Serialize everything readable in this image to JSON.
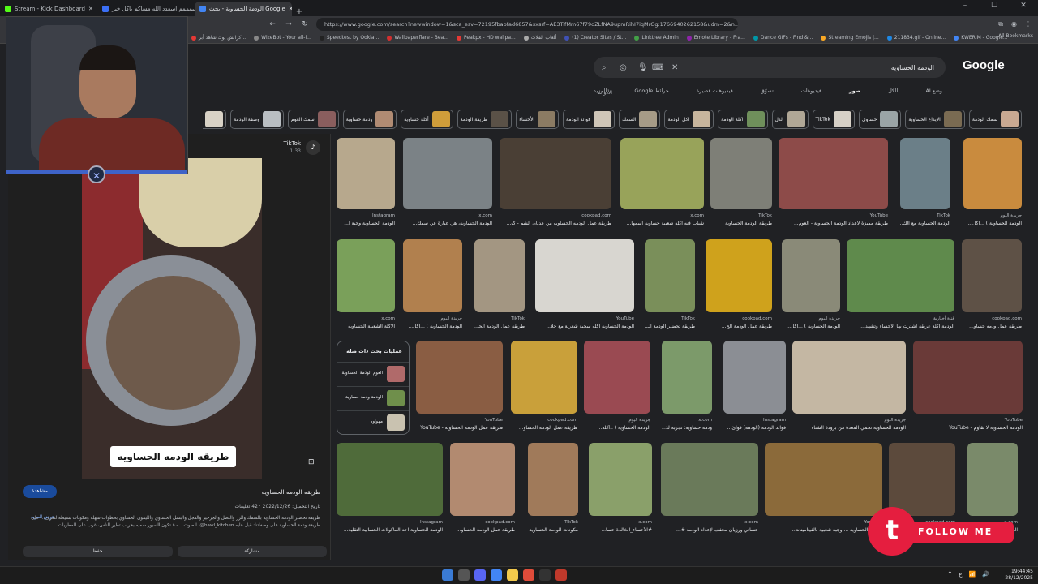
{
  "browser": {
    "tabs": [
      {
        "label": "Stream - Kick Dashboard",
        "color": "#53fc18"
      },
      {
        "label": "حييمممم اسعدد الله مساكم ياكل خير ||",
        "color": "#3b6ff5"
      },
      {
        "label": "الودمة الحساوية - بحث Google",
        "color": "#4285f4",
        "active": true
      }
    ],
    "new_tab": "+",
    "window_controls": [
      "–",
      "☐",
      "✕"
    ],
    "url": "https://www.google.com/search?newwindow=1&sca_esv=72195fbabfad6857&sxsrf=AE3TifMm67f79dZLfNA9upmRihI7iqMrGg:1766940262158&udm=2&n...",
    "bookmarks": [
      {
        "label": "كرانش يوك شاهد أبر...",
        "color": "#e53935"
      },
      {
        "label": "WizeBot - Your all-i...",
        "color": "#888888"
      },
      {
        "label": "Speedtest by Ookla...",
        "color": "#222222"
      },
      {
        "label": "Wallpaperflare - Bea...",
        "color": "#d32f2f"
      },
      {
        "label": "Peakpx - HD wallpa...",
        "color": "#e53935"
      },
      {
        "label": "ألعاب الفلات",
        "color": "#aaaaaa"
      },
      {
        "label": "(1) Creator Sites / St...",
        "color": "#3f51b5"
      },
      {
        "label": "Linktree Admin",
        "color": "#43a047"
      },
      {
        "label": "Emote Library - Fra...",
        "color": "#8e24aa"
      },
      {
        "label": "Dance GIFs - Find &...",
        "color": "#0097a7"
      },
      {
        "label": "Streaming Emojis |...",
        "color": "#f9a825"
      },
      {
        "label": "211834.gif - Online...",
        "color": "#1e88e5"
      },
      {
        "label": "KWERIM - Google...",
        "color": "#4285f4"
      }
    ],
    "all_bookmarks": "All Bookmarks"
  },
  "google": {
    "logo": "Google",
    "query": "الودمة الحساوية",
    "filters": [
      "وضع AI",
      "الكل",
      "صور",
      "فيديوهات",
      "تسوّق",
      "فيديوهات قصيرة",
      "خرائط Google",
      "المزيد"
    ],
    "active_filter": "صور",
    "tools": "الأدوات",
    "chips": [
      {
        "label": "سمك الودمة",
        "color": "#c9a992"
      },
      {
        "label": "الإبداع الحساوية",
        "color": "#7a6b52"
      },
      {
        "label": "حساوي",
        "color": "#9aa4a6"
      },
      {
        "label": "TikTok",
        "color": "#d6d0c6"
      },
      {
        "label": "الدل",
        "color": "#b0a796"
      },
      {
        "label": "اكلة الودمة",
        "color": "#6f8f5b"
      },
      {
        "label": "اكل الودمة",
        "color": "#c7b59d"
      },
      {
        "label": "السمك",
        "color": "#a69b87"
      },
      {
        "label": "فوائد الودمة",
        "color": "#cfc6b8"
      },
      {
        "label": "الأحساء",
        "color": "#8b7b63"
      },
      {
        "label": "طريقة الودمة",
        "color": "#5a5147"
      },
      {
        "label": "أكلة حساويه",
        "color": "#cf9d3a"
      },
      {
        "label": "ودمة حساوية",
        "color": "#b08b73"
      },
      {
        "label": "سمك العوم",
        "color": "#8a5e5e"
      },
      {
        "label": "وصفة الودمة",
        "color": "#b9bec2"
      },
      {
        "label": "عمل الودمة",
        "color": "#d8d2c6"
      }
    ]
  },
  "viewer": {
    "source": "TikTok",
    "duration": "1:33",
    "caption": "طريقه الودمه الحساويه",
    "visit": "مشاهدة",
    "title": "طريقه الودمه الحساويه",
    "meta": "تاريخ التحميل: 2022/12/26 · 42 تعليقات",
    "description": "طريقة تحضير الودمه الحساويه بالسمك والرز والبصل والجرجير والفجل والبسل الحساوي والليمون الحساوي بخطوات سهلة ومكونات بسيطة لتعرف... على طريقة ودمة الحساوية على وصفاتنا: قبل عليه hawl_kitchen@، الصوت... - ٥ تكون السيور سميه بحريب تطير الناس، غرب على المطويات",
    "more": "عرض المزيد",
    "actions": [
      "حفظ",
      "مشاركة"
    ]
  },
  "related": {
    "heading": "عمليات بحث ذات صلة",
    "items": [
      {
        "label": "العوم الودمة الحساوية",
        "color": "#b06a6a"
      },
      {
        "label": "الودمة ودمة حساوية",
        "color": "#6f8f4b"
      },
      {
        "label": "مهواوه",
        "color": "#c9c2b0"
      }
    ]
  },
  "grid": {
    "cards": [
      {
        "src": "Instagram",
        "title": "الودمة الحساوية وجبة ا...",
        "color": "#b7a88d"
      },
      {
        "src": "x.com",
        "title": "الودمة الحساوية، هي عبارة عن سمك...",
        "color": "#7b8286"
      },
      {
        "src": "cookpad.com",
        "title": "طريقة عمل الودمه الحساويه من عدنان الشم - ک...",
        "color": "#4a3f35"
      },
      {
        "src": "x.com",
        "title": "شباب فيه أكله شعبية حساوية اسمها...",
        "color": "#98a35a"
      },
      {
        "src": "TikTok",
        "title": "طريقة الودمة الحساوية",
        "color": "#7e7f77"
      },
      {
        "src": "YouTube",
        "title": "طريقة مميزة لاعداد الودمة الحساوية - العوم...",
        "color": "#8d4b49"
      },
      {
        "src": "TikTok",
        "title": "الودمة الحساوية مع الك...",
        "color": "#6b7f88"
      },
      {
        "src": "جريدة اليوم",
        "title": "الودمة الحساوية ) ...أكل...",
        "color": "#c98b3e"
      },
      {
        "src": "x.com",
        "title": "الأكلة الشعبية الحساويه",
        "color": "#7aa05a"
      },
      {
        "src": "جريدة اليوم",
        "title": "الودمة الحساوية ) ...أكل...",
        "color": "#b1804e"
      },
      {
        "src": "TikTok",
        "title": "طريقة عمل الودمة الحـ...",
        "color": "#a39682"
      },
      {
        "src": "YouTube",
        "title": "الودمة الحساوية أكله سحبة شعرية مع حلا...",
        "color": "#d8d6d0"
      },
      {
        "src": "TikTok",
        "title": "طريقة تحضير الودمة الـ...",
        "color": "#7a8f5a"
      },
      {
        "src": "cookpad.com",
        "title": "طريقة عمل الودمة الح...",
        "color": "#cfa21c"
      },
      {
        "src": "جريدة اليوم",
        "title": "الودمة الحساوية ) ...أكل...",
        "color": "#8a8a78"
      },
      {
        "src": "قناة أخبارية",
        "title": "الودمة أكلة عريقة اشترت بها الأحساء وتشهد...",
        "color": "#5f8a4c"
      },
      {
        "src": "cookpad.com",
        "title": "طريقة عمل ودمه حساو...",
        "color": "#5e5146"
      },
      {
        "src": "YouTube",
        "title": "طريقة عمل الودمة الحساوية - YouTube",
        "color": "#8a5d43"
      },
      {
        "src": "cookpad.com",
        "title": "طريقة عمل الودمه الحساو...",
        "color": "#c9a03a"
      },
      {
        "src": "جريدة اليوم",
        "title": "الودمة الحساوية ) ..أكلة...",
        "color": "#9a4a52"
      },
      {
        "src": "x.com",
        "title": "ودمه حساوية: تجربة لذ...",
        "color": "#7c9a6a"
      },
      {
        "src": "Instagram",
        "title": "فوائد الودمة (الودمه) فوائ...",
        "color": "#8b8e94"
      },
      {
        "src": "جريدة اليوم",
        "title": "الودمة الحساوية تحمي المعدة من برودة الشتاء",
        "color": "#c4b7a3"
      },
      {
        "src": "YouTube",
        "title": "الودمة الحساوية لا تقاوم - YouTube",
        "color": "#6a3a38"
      },
      {
        "src": "Instagram",
        "title": "الودمة الحساوية احد الماكولات الحسائية التقليد...",
        "color": "#4f6b3a"
      },
      {
        "src": "cookpad.com",
        "title": "طريقة عمل الودمة الحساو...",
        "color": "#b28a70"
      },
      {
        "src": "TikTok",
        "title": "مكونات الودمة الحساوية",
        "color": "#a07a5a"
      },
      {
        "src": "x.com",
        "title": "#الأحساء_الخالدة حسا...",
        "color": "#8aa06a"
      },
      {
        "src": "x.com",
        "title": "حساني ورزيان مجفف لإعداد الودمة #...",
        "color": "#6a7a5a"
      },
      {
        "src": "YouTube",
        "title": "الودمة الحساوية ... وجبة شعبية بالفيتامينات...",
        "color": "#8b6a3a"
      },
      {
        "src": "cookpad.com",
        "title": "الودمه",
        "color": "#5c4a3c"
      },
      {
        "src": "x.com",
        "title": "الودمة الحساوية",
        "color": "#7a8a6a"
      }
    ]
  },
  "overlay": {
    "follow_badge": "t",
    "follow_text": "FOLLOW ME"
  },
  "taskbar": {
    "tray": [
      "^",
      "ع",
      "📶",
      "🔊"
    ],
    "time": "19:44:45",
    "date": "28/12/2025"
  }
}
